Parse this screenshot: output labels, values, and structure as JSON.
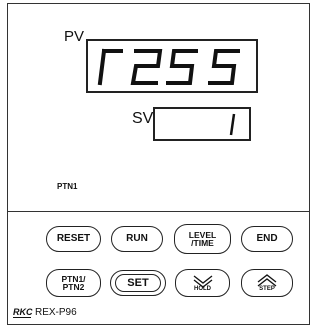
{
  "display": {
    "pv_label": "PV",
    "pv_value": "r255",
    "sv_label": "SV",
    "sv_value": "1",
    "pattern_indicator": "PTN1"
  },
  "buttons": {
    "reset": "RESET",
    "run": "RUN",
    "level_time": "LEVEL\n/TIME",
    "end": "END",
    "ptn": "PTN1/\nPTN2",
    "set": "SET",
    "hold": "HOLD",
    "step": "STEP"
  },
  "footer": {
    "logo": "RKC",
    "model": "REX-P96"
  }
}
